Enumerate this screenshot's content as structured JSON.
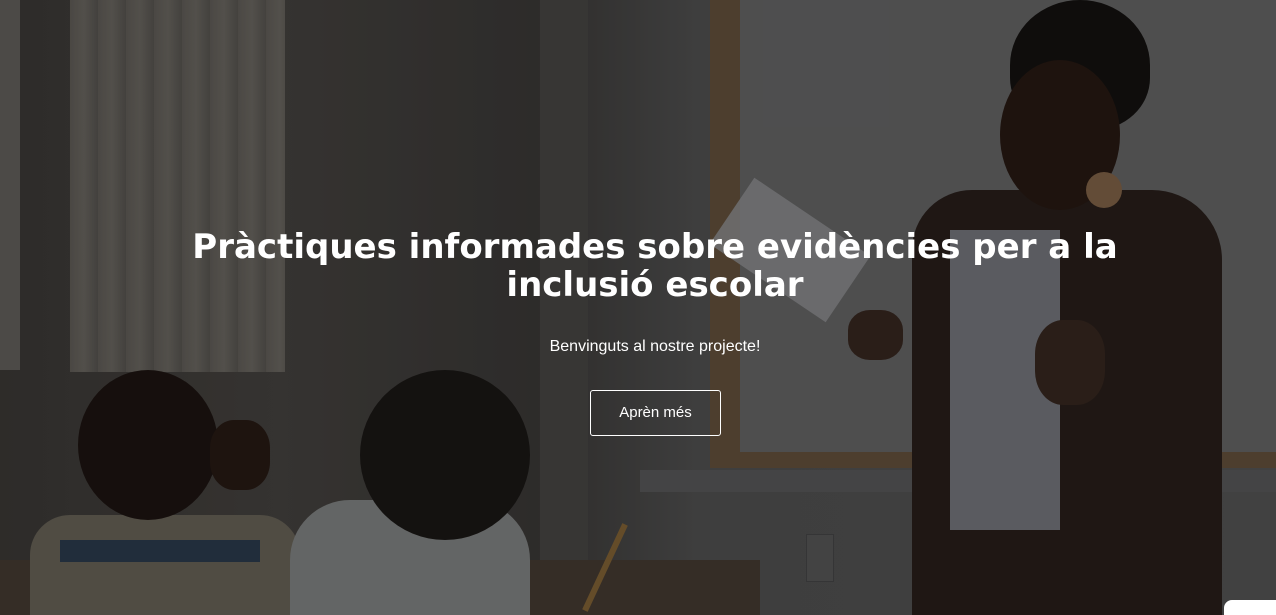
{
  "hero": {
    "title": "Pràctiques informades sobre evidències per a la inclusió escolar",
    "subtitle": "Benvinguts al nostre projecte!",
    "cta_label": "Aprèn més"
  },
  "colors": {
    "text": "#ffffff",
    "button_border": "#ffffff"
  }
}
